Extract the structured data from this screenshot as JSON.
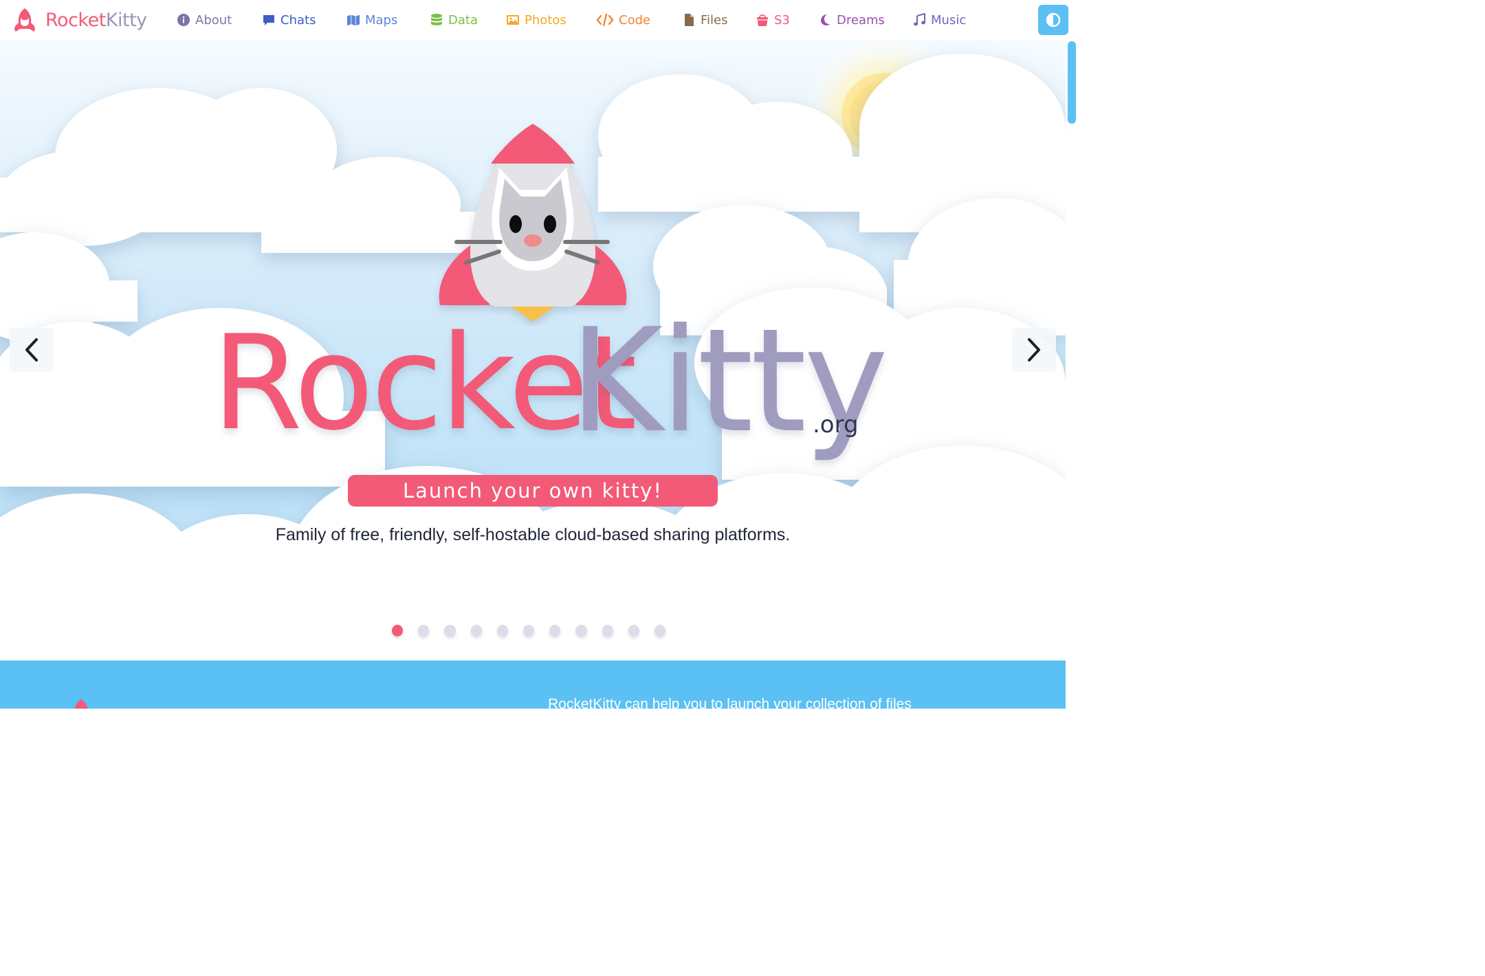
{
  "brand": {
    "rocket": "Rocket",
    "kitty": "Kitty"
  },
  "nav": {
    "items": [
      {
        "label": "About",
        "icon": "info-circle-icon",
        "color": "#7a76a8"
      },
      {
        "label": "Chats",
        "icon": "chat-bubble-icon",
        "color": "#3b5fc0"
      },
      {
        "label": "Maps",
        "icon": "map-icon",
        "color": "#5a86d8"
      },
      {
        "label": "Data",
        "icon": "database-icon",
        "color": "#76c043"
      },
      {
        "label": "Photos",
        "icon": "image-icon",
        "color": "#f5a623"
      },
      {
        "label": "Code",
        "icon": "code-icon",
        "color": "#f2842f"
      },
      {
        "label": "Files",
        "icon": "file-icon",
        "color": "#8a6a4e"
      },
      {
        "label": "S3",
        "icon": "bucket-icon",
        "color": "#f25a77"
      },
      {
        "label": "Dreams",
        "icon": "moon-icon",
        "color": "#9b4fb0"
      },
      {
        "label": "Music",
        "icon": "music-note-icon",
        "color": "#7a62b8"
      }
    ],
    "theme_toggle_icon": "contrast-icon"
  },
  "hero": {
    "title_rocket": "Rocket",
    "title_kitty": "Kitty",
    "title_suffix": ".org",
    "badge": "Launch your own kitty!",
    "tagline": "Family of free, friendly, self-hostable cloud-based sharing platforms.",
    "prev_icon": "chevron-left-icon",
    "next_icon": "chevron-right-icon",
    "slides": {
      "count": 11,
      "active": 1
    }
  },
  "info": {
    "text": "RocketKitty can help you to launch your collection of files"
  },
  "colors": {
    "accent_pink": "#f25a77",
    "accent_lavender": "#9f9cbf",
    "accent_blue": "#5bc0f3"
  }
}
